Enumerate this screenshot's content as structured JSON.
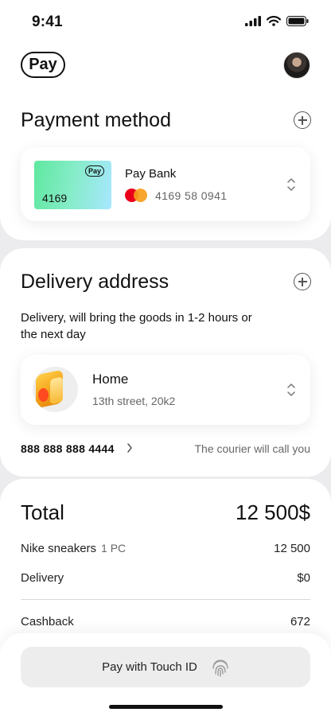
{
  "status_bar": {
    "time": "9:41"
  },
  "header": {
    "logo": "Pay"
  },
  "payment": {
    "title": "Payment method",
    "card": {
      "brand": "Pay",
      "last4": "4169",
      "bank": "Pay Bank",
      "number": "4169 58 0941"
    }
  },
  "delivery": {
    "title": "Delivery address",
    "description": "Delivery, will bring the goods in 1-2 hours or the next day",
    "address": {
      "title": "Home",
      "street": "13th street, 20k2"
    },
    "phone": "888 888 888 4444",
    "courier_note": "The courier will call you"
  },
  "total": {
    "label": "Total",
    "value": "12 500$",
    "items": [
      {
        "label": "Nike sneakers",
        "qty": "1 PC",
        "value": "12 500"
      },
      {
        "label": "Delivery",
        "value": "$0"
      },
      {
        "label": "Cashback",
        "value": "672"
      }
    ]
  },
  "pay_button": {
    "label": "Pay with Touch ID"
  },
  "colors": {
    "accent_card_start": "#5fe89f",
    "accent_card_end": "#a7e7ff",
    "mastercard_red": "#eb001b",
    "mastercard_orange": "#f79e1b"
  }
}
